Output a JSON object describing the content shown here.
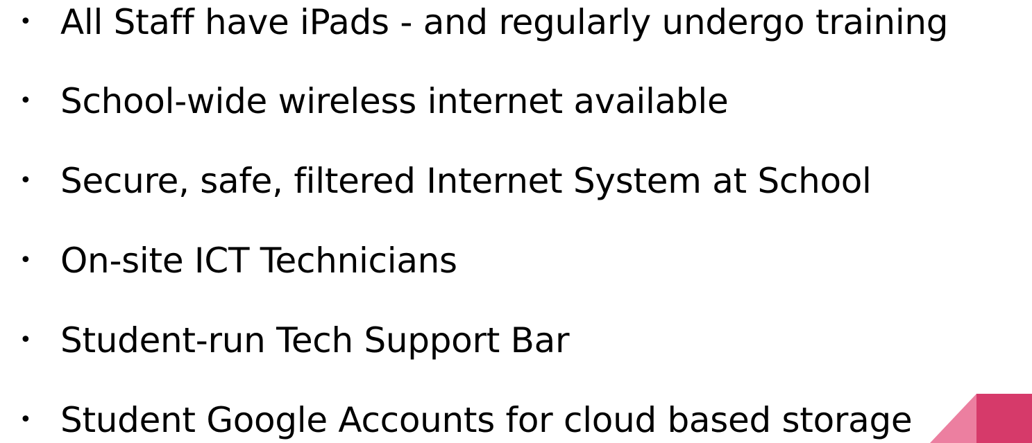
{
  "slide": {
    "accent_color": "#D63A6A",
    "accent_light_color": "#EC7FA0",
    "bullets": [
      {
        "marker": "•",
        "text": "All Staff have iPads - and regularly undergo training"
      },
      {
        "marker": "•",
        "text": "School-wide wireless internet available"
      },
      {
        "marker": "•",
        "text": "Secure, safe, filtered Internet System at School"
      },
      {
        "marker": "•",
        "text": "On-site ICT Technicians"
      },
      {
        "marker": "•",
        "text": "Student-run Tech Support Bar"
      },
      {
        "marker": "•",
        "text": "Student Google Accounts for cloud based storage"
      }
    ]
  }
}
